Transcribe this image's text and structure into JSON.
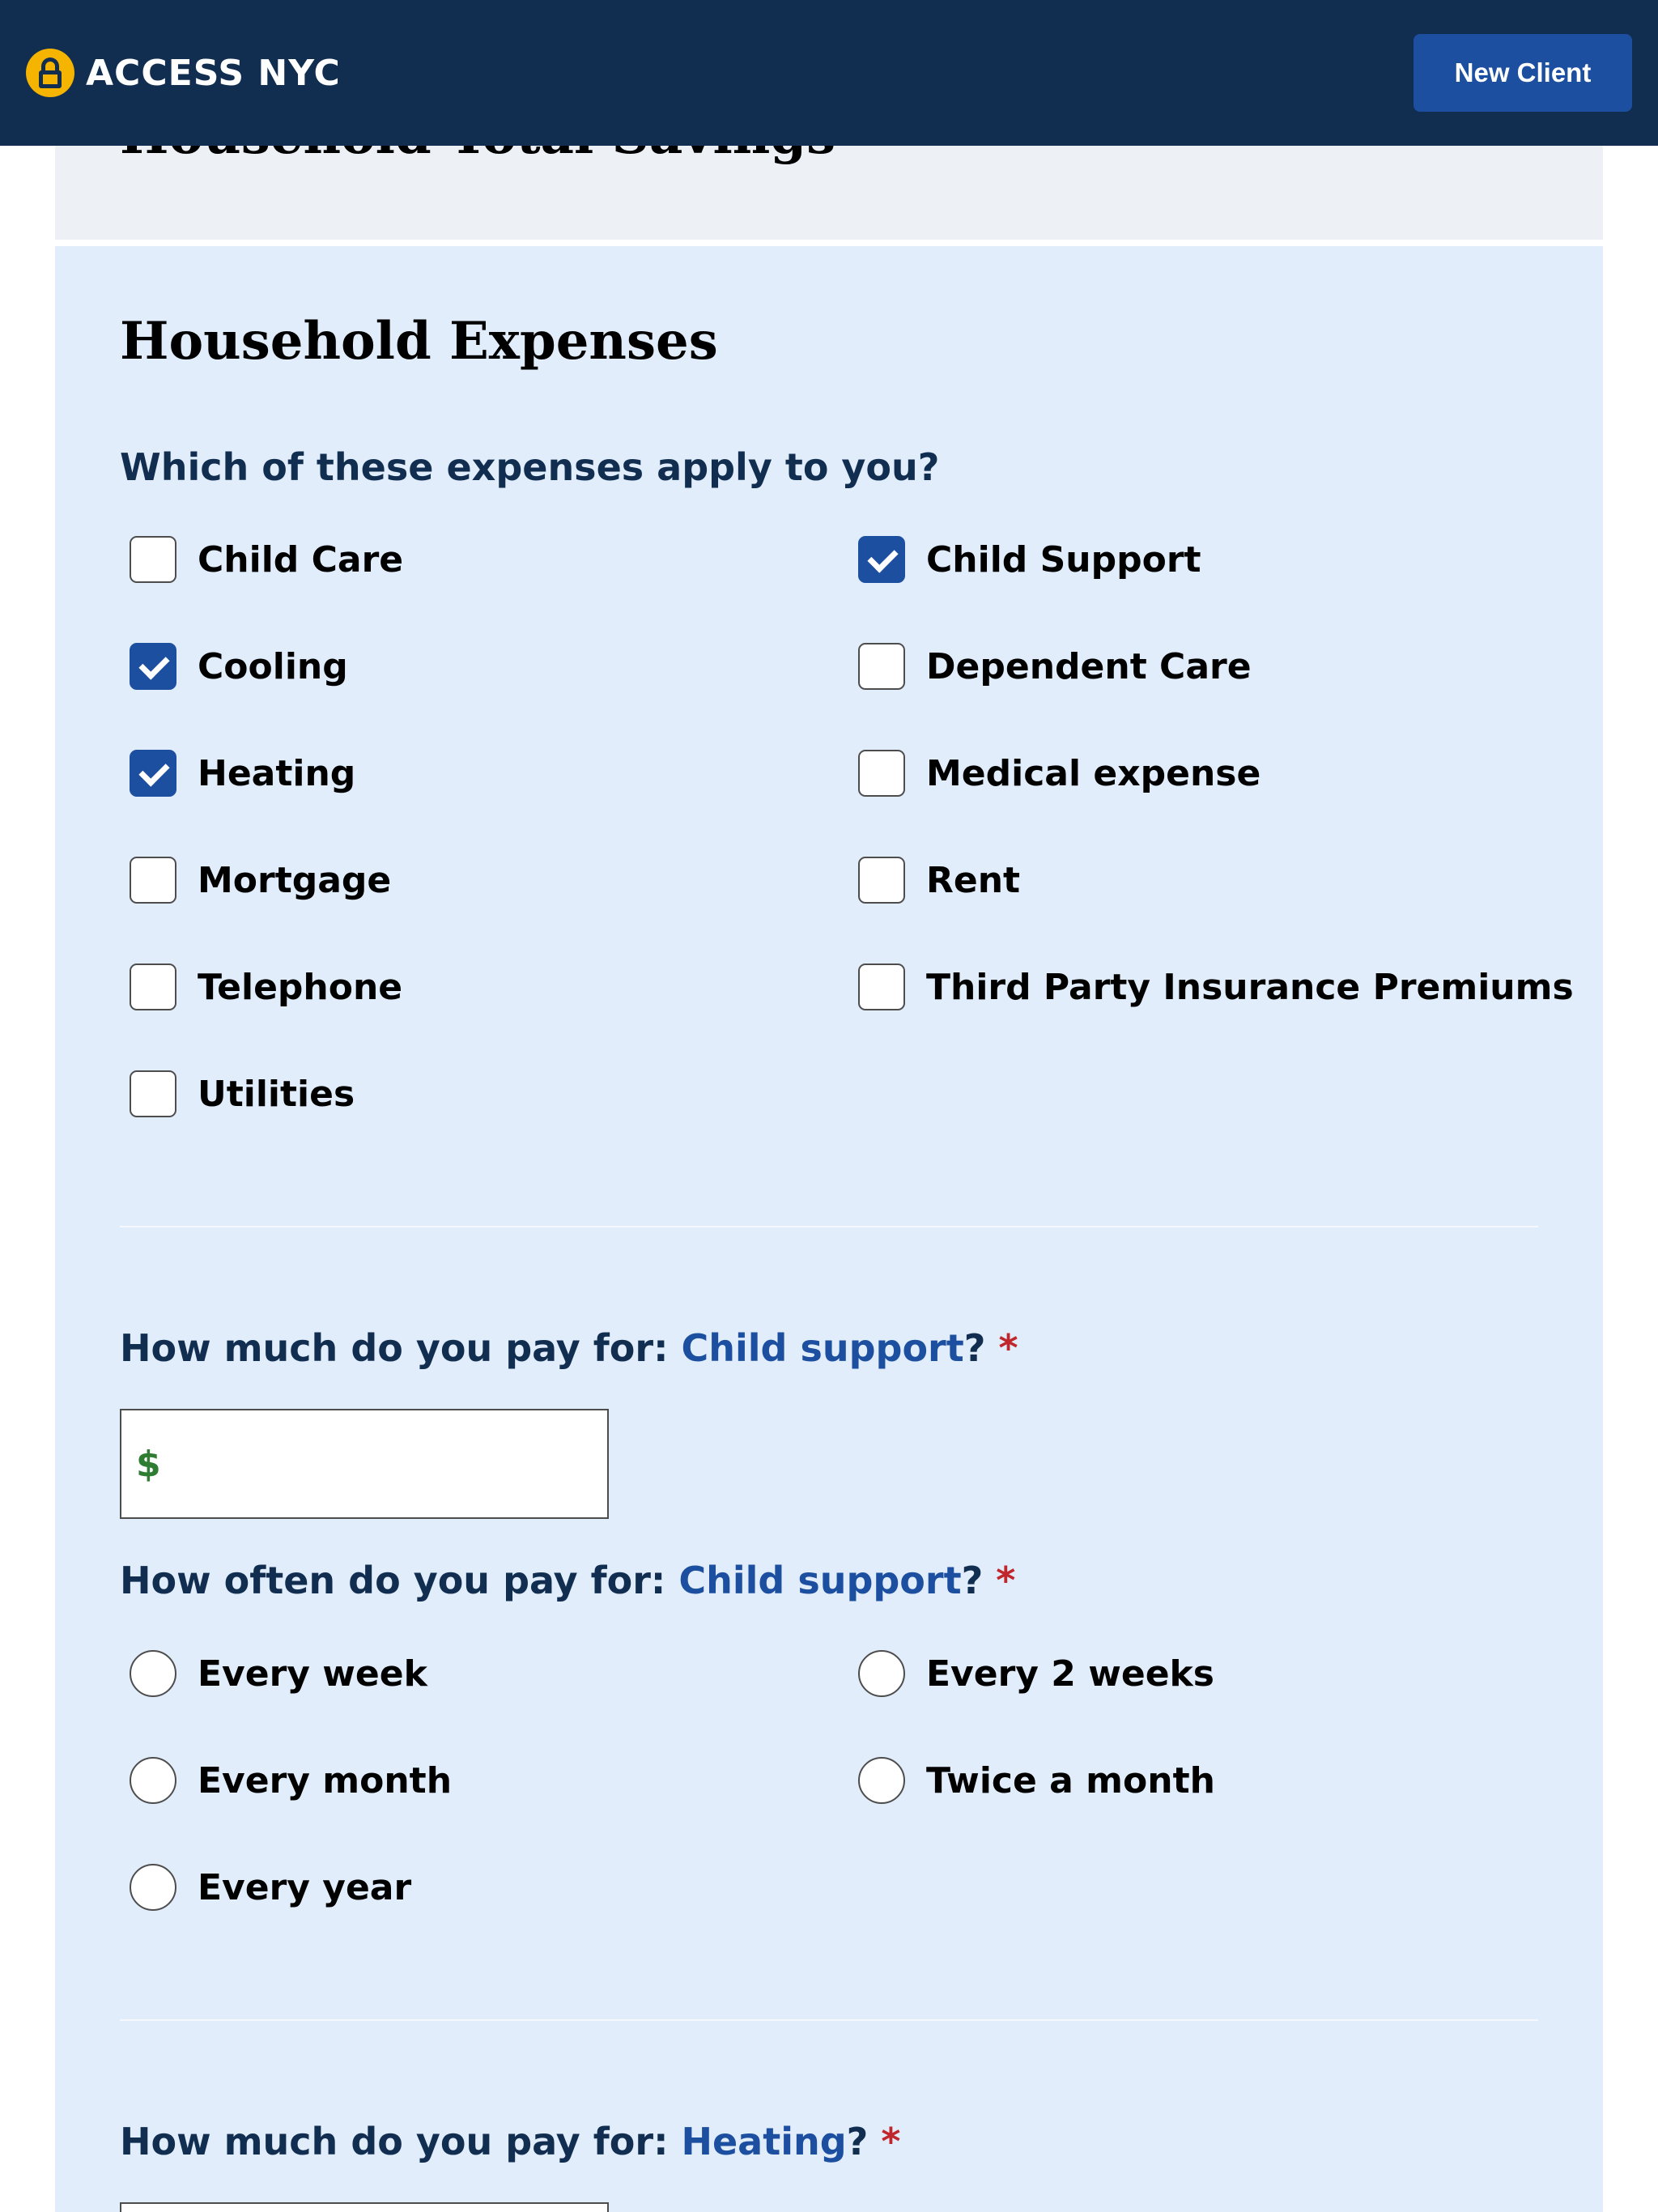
{
  "header": {
    "app_name": "ACCESS NYC",
    "new_client_label": "New Client",
    "colors": {
      "bar": "#112e51",
      "button": "#1d4fa0",
      "logo": "#f4b400"
    }
  },
  "savings_section": {
    "title": "Household Total Savings"
  },
  "expenses_section": {
    "title": "Household Expenses",
    "question": "Which of these expenses apply to you?",
    "options": [
      {
        "label": "Child Care",
        "checked": false
      },
      {
        "label": "Child Support",
        "checked": true
      },
      {
        "label": "Cooling",
        "checked": true
      },
      {
        "label": "Dependent Care",
        "checked": false
      },
      {
        "label": "Heating",
        "checked": true
      },
      {
        "label": "Medical expense",
        "checked": false
      },
      {
        "label": "Mortgage",
        "checked": false
      },
      {
        "label": "Rent",
        "checked": false
      },
      {
        "label": "Telephone",
        "checked": false
      },
      {
        "label": "Third Party Insurance Premiums",
        "checked": false
      },
      {
        "label": "Utilities",
        "checked": false
      }
    ]
  },
  "child_support": {
    "amount_prefix": "How much do you pay for: ",
    "amount_item": "Child support",
    "amount_suffix": "?",
    "required_mark": "*",
    "currency_symbol": "$",
    "amount_value": "",
    "frequency_prefix": "How often do you pay for: ",
    "frequency_item": "Child support",
    "frequency_suffix": "?",
    "frequency_options": [
      "Every week",
      "Every 2 weeks",
      "Every month",
      "Twice a month",
      "Every year"
    ]
  },
  "heating": {
    "amount_prefix": "How much do you pay for: ",
    "amount_item": "Heating",
    "amount_suffix": "?",
    "required_mark": "*"
  }
}
